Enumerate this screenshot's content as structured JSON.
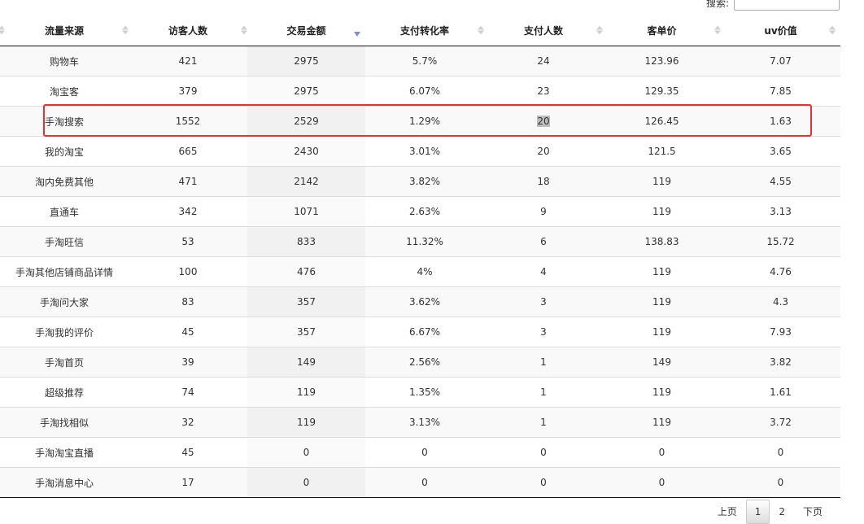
{
  "search": {
    "label": "搜索:",
    "value": ""
  },
  "table": {
    "columns": [
      "流量来源",
      "访客人数",
      "交易金额",
      "支付转化率",
      "支付人数",
      "客单价",
      "uv价值"
    ],
    "rows": [
      [
        "购物车",
        "421",
        "2975",
        "5.7%",
        "24",
        "123.96",
        "7.07"
      ],
      [
        "淘宝客",
        "379",
        "2975",
        "6.07%",
        "23",
        "129.35",
        "7.85"
      ],
      [
        "手淘搜索",
        "1552",
        "2529",
        "1.29%",
        "20",
        "126.45",
        "1.63"
      ],
      [
        "我的淘宝",
        "665",
        "2430",
        "3.01%",
        "20",
        "121.5",
        "3.65"
      ],
      [
        "淘内免费其他",
        "471",
        "2142",
        "3.82%",
        "18",
        "119",
        "4.55"
      ],
      [
        "直通车",
        "342",
        "1071",
        "2.63%",
        "9",
        "119",
        "3.13"
      ],
      [
        "手淘旺信",
        "53",
        "833",
        "11.32%",
        "6",
        "138.83",
        "15.72"
      ],
      [
        "手淘其他店铺商品详情",
        "100",
        "476",
        "4%",
        "4",
        "119",
        "4.76"
      ],
      [
        "手淘问大家",
        "83",
        "357",
        "3.62%",
        "3",
        "119",
        "4.3"
      ],
      [
        "手淘我的评价",
        "45",
        "357",
        "6.67%",
        "3",
        "119",
        "7.93"
      ],
      [
        "手淘首页",
        "39",
        "149",
        "2.56%",
        "1",
        "149",
        "3.82"
      ],
      [
        "超级推荐",
        "74",
        "119",
        "1.35%",
        "1",
        "119",
        "1.61"
      ],
      [
        "手淘找相似",
        "32",
        "119",
        "3.13%",
        "1",
        "119",
        "3.72"
      ],
      [
        "手淘淘宝直播",
        "45",
        "0",
        "0",
        "0",
        "0",
        "0"
      ],
      [
        "手淘消息中心",
        "17",
        "0",
        "0",
        "0",
        "0",
        "0"
      ]
    ]
  },
  "pagination": {
    "prev": "上页",
    "pages": [
      "1",
      "2"
    ],
    "current": "1",
    "next": "下页"
  },
  "colors": {
    "highlight": "#e53333",
    "sort_active": "#7f8fc8"
  }
}
